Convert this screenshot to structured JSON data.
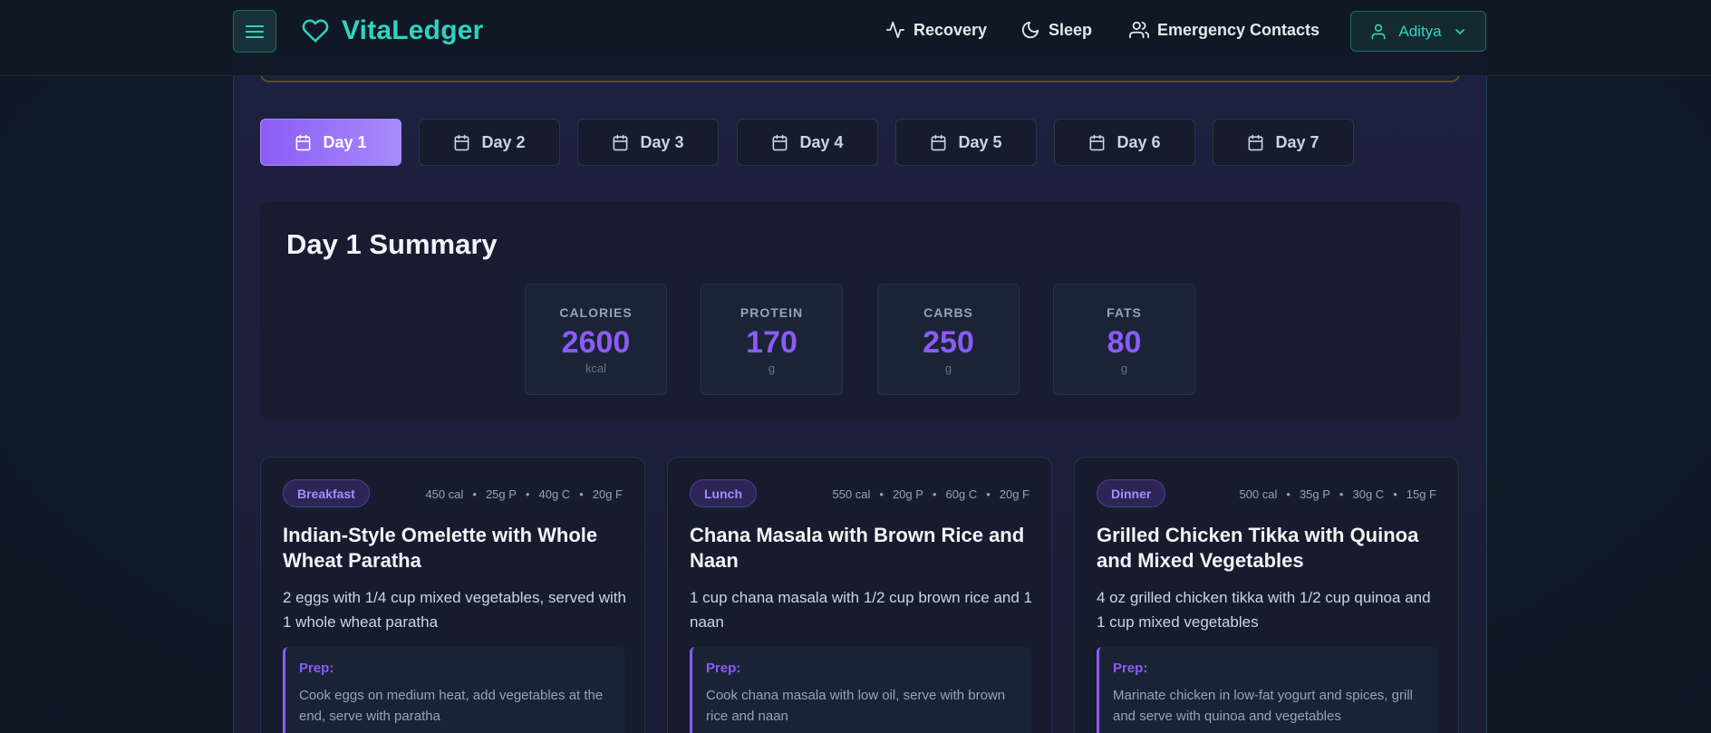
{
  "app": {
    "name": "VitaLedger"
  },
  "nav": [
    {
      "label": "Recovery",
      "icon": "activity-icon"
    },
    {
      "label": "Sleep",
      "icon": "moon-icon"
    },
    {
      "label": "Emergency Contacts",
      "icon": "users-icon"
    }
  ],
  "user": {
    "name": "Aditya"
  },
  "days": [
    "Day 1",
    "Day 2",
    "Day 3",
    "Day 4",
    "Day 5",
    "Day 6",
    "Day 7"
  ],
  "active_day": "Day 1",
  "summary": {
    "title": "Day 1 Summary",
    "stats": [
      {
        "label": "CALORIES",
        "value": "2600",
        "unit": "kcal"
      },
      {
        "label": "PROTEIN",
        "value": "170",
        "unit": "g"
      },
      {
        "label": "CARBS",
        "value": "250",
        "unit": "g"
      },
      {
        "label": "FATS",
        "value": "80",
        "unit": "g"
      }
    ]
  },
  "meals": [
    {
      "type": "Breakfast",
      "macros": [
        "450 cal",
        "25g P",
        "40g C",
        "20g F"
      ],
      "title": "Indian-Style Omelette with Whole Wheat Paratha",
      "description": "2 eggs with 1/4 cup mixed vegetables, served with 1 whole wheat paratha",
      "prep_label": "Prep:",
      "prep": "Cook eggs on medium heat, add vegetables at the end, serve with paratha"
    },
    {
      "type": "Lunch",
      "macros": [
        "550 cal",
        "20g P",
        "60g C",
        "20g F"
      ],
      "title": "Chana Masala with Brown Rice and Naan",
      "description": "1 cup chana masala with 1/2 cup brown rice and 1 naan",
      "prep_label": "Prep:",
      "prep": "Cook chana masala with low oil, serve with brown rice and naan"
    },
    {
      "type": "Dinner",
      "macros": [
        "500 cal",
        "35g P",
        "30g C",
        "15g F"
      ],
      "title": "Grilled Chicken Tikka with Quinoa and Mixed Vegetables",
      "description": "4 oz grilled chicken tikka with 1/2 cup quinoa and 1 cup mixed vegetables",
      "prep_label": "Prep:",
      "prep": "Marinate chicken in low-fat yogurt and spices, grill and serve with quinoa and vegetables"
    }
  ],
  "colors": {
    "accent": "#8b5cf6",
    "brand": "#2dd4bf"
  }
}
